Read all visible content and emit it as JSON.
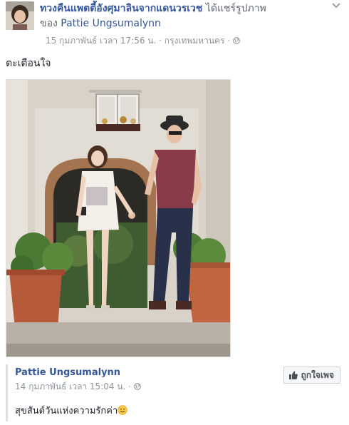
{
  "post": {
    "page_name": "ทวงคืนแพตตี้อังศุมาลินจากแดนวรเวช",
    "shared_text": " ได้แชร์รูปภาพ",
    "owner_prefix": "ของ ",
    "owner_name": "Pattie Ungsumalynn",
    "timestamp": "15 กุมภาพันธ์ เวลา 17:56 น.",
    "separator": " · ",
    "location": "กรุงเทพมหานคร",
    "text": "ตะเตือนใจ"
  },
  "shared_post": {
    "author": "Pattie Ungsumalynn",
    "timestamp": "14 กุมภาพันธ์ เวลา 15:04 น.",
    "separator": " · ",
    "text": "สุขสันต์วันแห่งความรักค่า",
    "like_page_label": "ถูกใจเพจ"
  },
  "icons": {
    "options": "chevron-down-icon",
    "privacy": "globe-icon",
    "like": "thumbs-up-icon",
    "emoji": "smile-emoji-icon"
  },
  "colors": {
    "link": "#365899",
    "meta": "#90949c",
    "text": "#1d2129"
  }
}
